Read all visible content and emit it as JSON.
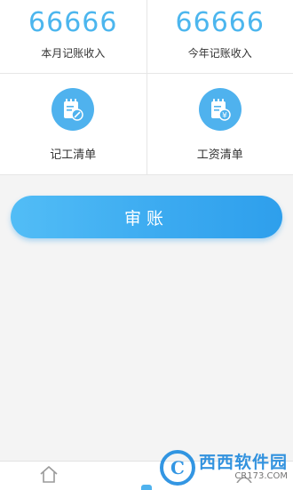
{
  "stats": [
    {
      "value": "66666",
      "label": "本月记账收入"
    },
    {
      "value": "66666",
      "label": "今年记账收入"
    }
  ],
  "menu": [
    {
      "label": "记工清单",
      "icon": "notebook-pen-icon"
    },
    {
      "label": "工资清单",
      "icon": "notebook-yen-icon"
    }
  ],
  "audit_button": {
    "label": "审账"
  },
  "tabbar": {
    "tabs": [
      {
        "icon": "home-icon"
      },
      {
        "icon": "ledger-icon",
        "active": true
      },
      {
        "icon": "profile-icon"
      }
    ]
  },
  "watermark": {
    "brand": "西西软件园",
    "domain": "CR173.COM"
  },
  "colors": {
    "accent": "#4fb2ee",
    "stat_value": "#4cb6ee",
    "background": "#f4f4f4"
  }
}
